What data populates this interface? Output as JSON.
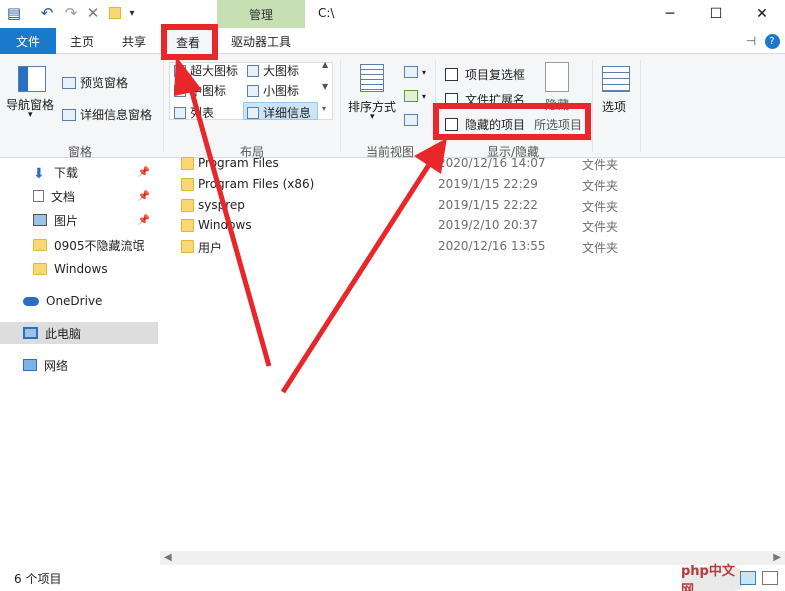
{
  "window": {
    "manage_tab": "管理",
    "path_title": "C:\\",
    "minimize_glyph": "─",
    "maximize_glyph": "☐",
    "close_glyph": "✕"
  },
  "tabs": {
    "file": "文件",
    "home": "主页",
    "share": "共享",
    "view": "查看",
    "drive_tools": "驱动器工具"
  },
  "ribbon": {
    "panes": {
      "nav_pane": "导航窗格",
      "preview_pane": "预览窗格",
      "details_pane": "详细信息窗格",
      "label": "窗格"
    },
    "layout": {
      "extra_large": "超大图标",
      "large": "大图标",
      "medium": "中图标",
      "small": "小图标",
      "list": "列表",
      "details": "详细信息",
      "label": "布局"
    },
    "current_view": {
      "sort_by": "排序方式",
      "label": "当前视图"
    },
    "show_hide": {
      "item_checkboxes": "项目复选框",
      "file_extensions": "文件扩展名",
      "hidden_items": "隐藏的项目",
      "hide_selected": "所选项目",
      "hide_button": "隐藏",
      "label": "显示/隐藏"
    },
    "options": "选项"
  },
  "nav": {
    "items": [
      {
        "label": "下载",
        "icon": "download-arrow-icon",
        "pinned": true
      },
      {
        "label": "文档",
        "icon": "document-icon",
        "pinned": true
      },
      {
        "label": "图片",
        "icon": "picture-icon",
        "pinned": true
      },
      {
        "label": "0905不隐藏流氓",
        "icon": "folder-icon",
        "pinned": false
      },
      {
        "label": "Windows",
        "icon": "folder-icon",
        "pinned": false
      },
      {
        "label": "OneDrive",
        "icon": "cloud-icon",
        "pinned": false
      },
      {
        "label": "此电脑",
        "icon": "computer-icon",
        "pinned": false
      },
      {
        "label": "网络",
        "icon": "network-icon",
        "pinned": false
      }
    ]
  },
  "files": {
    "rows": [
      {
        "name": "Program Files",
        "date": "2020/12/16 14:07",
        "type": "文件夹"
      },
      {
        "name": "Program Files (x86)",
        "date": "2019/1/15 22:29",
        "type": "文件夹"
      },
      {
        "name": "sysprep",
        "date": "2019/1/15 22:22",
        "type": "文件夹"
      },
      {
        "name": "Windows",
        "date": "2019/2/10 20:37",
        "type": "文件夹"
      },
      {
        "name": "用户",
        "date": "2020/12/16 13:55",
        "type": "文件夹"
      }
    ]
  },
  "status": {
    "count": "6 个项目",
    "watermark": "php中文网"
  },
  "colors": {
    "accent_blue": "#1979ca",
    "manage_green": "#c6e0b4",
    "annotation_red": "#e8272a"
  }
}
